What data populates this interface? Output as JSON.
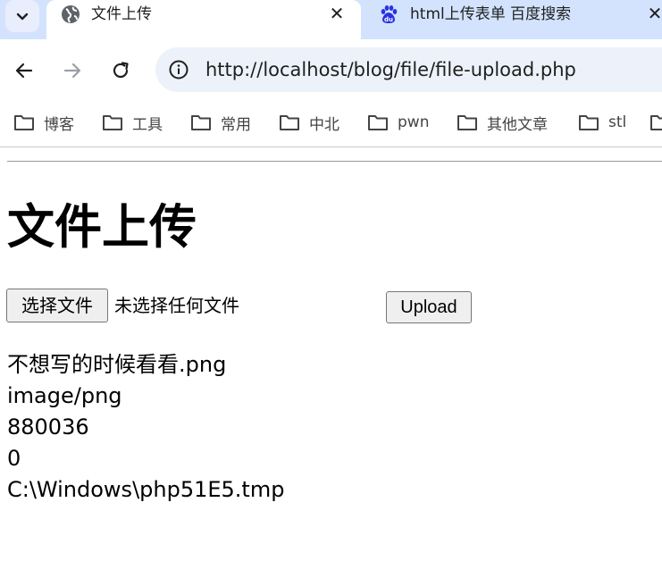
{
  "tabs": [
    {
      "title": "文件上传",
      "active": true,
      "icon": "globe-icon"
    },
    {
      "title": "html上传表单 百度搜索",
      "active": false,
      "icon": "baidu-paw-icon"
    }
  ],
  "toolbar": {
    "url": "http://localhost/blog/file/file-upload.php"
  },
  "bookmarks": [
    "博客",
    "工具",
    "常用",
    "中北",
    "pwn",
    "其他文章",
    "stl"
  ],
  "page": {
    "heading": "文件上传",
    "choose_file_label": "选择文件",
    "no_file_label": "未选择任何文件",
    "upload_label": "Upload",
    "file_info": {
      "name": "不想写的时候看看.png",
      "type": "image/png",
      "size": "880036",
      "error": "0",
      "tmp_name": "C:\\Windows\\php51E5.tmp"
    }
  },
  "colors": {
    "tabstrip": "#d3e3fd",
    "omnibox": "#edf2fa",
    "text": "#1f1f1f"
  }
}
